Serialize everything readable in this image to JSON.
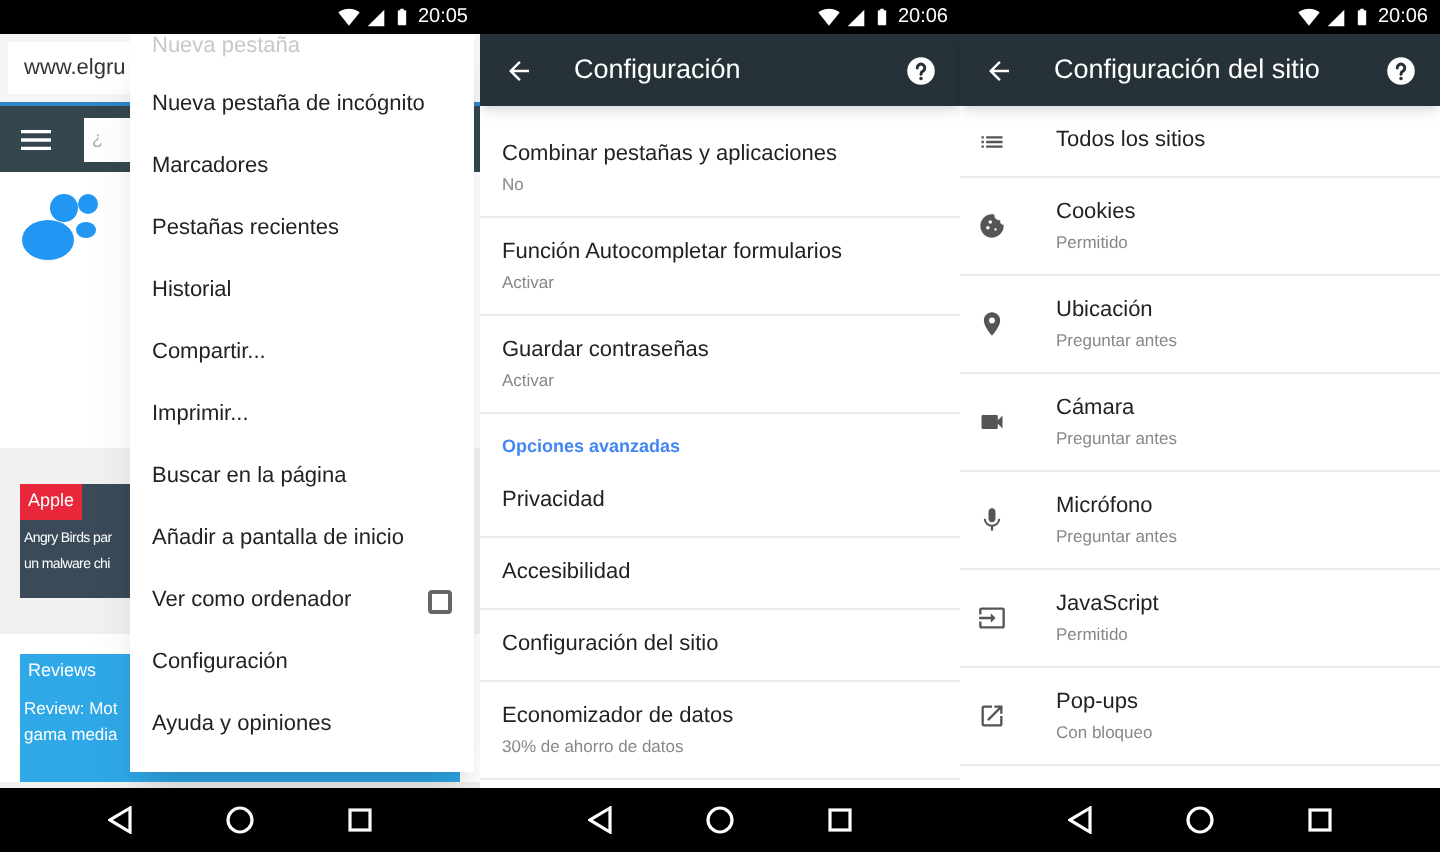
{
  "screens": [
    {
      "status_bar": {
        "time": "20:05"
      },
      "browser": {
        "url": "www.elgru",
        "search_placeholder": "¿",
        "articles": [
          {
            "tag": "Apple",
            "color": "#e8283a",
            "lines": [
              "Angry Birds par",
              "un malware chi"
            ]
          },
          {
            "tag": "Reviews",
            "color": "#2fa8e8",
            "lines": [
              "Review: Mot",
              "gama media"
            ]
          }
        ]
      },
      "menu": {
        "items": [
          {
            "label": "Nueva pestaña",
            "kind": "faded"
          },
          {
            "label": "Nueva pestaña de incógnito",
            "kind": "plain"
          },
          {
            "label": "Marcadores",
            "kind": "plain"
          },
          {
            "label": "Pestañas recientes",
            "kind": "plain"
          },
          {
            "label": "Historial",
            "kind": "plain"
          },
          {
            "label": "Compartir...",
            "kind": "plain"
          },
          {
            "label": "Imprimir...",
            "kind": "plain"
          },
          {
            "label": "Buscar en la página",
            "kind": "plain"
          },
          {
            "label": "Añadir a pantalla de inicio",
            "kind": "plain"
          },
          {
            "label": "Ver como ordenador",
            "kind": "checkbox",
            "checked": false
          },
          {
            "label": "Configuración",
            "kind": "plain"
          },
          {
            "label": "Ayuda y opiniones",
            "kind": "plain"
          }
        ]
      }
    },
    {
      "status_bar": {
        "time": "20:06"
      },
      "toolbar": {
        "title": "Configuración"
      },
      "settings": [
        {
          "kind": "item",
          "title": "Combinar pestañas y aplicaciones",
          "subtitle": "No"
        },
        {
          "kind": "item",
          "title": "Función Autocompletar formularios",
          "subtitle": "Activar"
        },
        {
          "kind": "item",
          "title": "Guardar contraseñas",
          "subtitle": "Activar"
        },
        {
          "kind": "header",
          "title": "Opciones avanzadas"
        },
        {
          "kind": "item",
          "title": "Privacidad"
        },
        {
          "kind": "item",
          "title": "Accesibilidad"
        },
        {
          "kind": "item",
          "title": "Configuración del sitio"
        },
        {
          "kind": "item",
          "title": "Economizador de datos",
          "subtitle": "30% de ahorro de datos"
        }
      ]
    },
    {
      "status_bar": {
        "time": "20:06"
      },
      "toolbar": {
        "title": "Configuración del sitio"
      },
      "site_settings": [
        {
          "title": "Todos los sitios"
        },
        {
          "title": "Cookies",
          "subtitle": "Permitido"
        },
        {
          "title": "Ubicación",
          "subtitle": "Preguntar antes"
        },
        {
          "title": "Cámara",
          "subtitle": "Preguntar antes"
        },
        {
          "title": "Micrófono",
          "subtitle": "Preguntar antes"
        },
        {
          "title": "JavaScript",
          "subtitle": "Permitido"
        },
        {
          "title": "Pop-ups",
          "subtitle": "Con bloqueo"
        }
      ]
    }
  ]
}
